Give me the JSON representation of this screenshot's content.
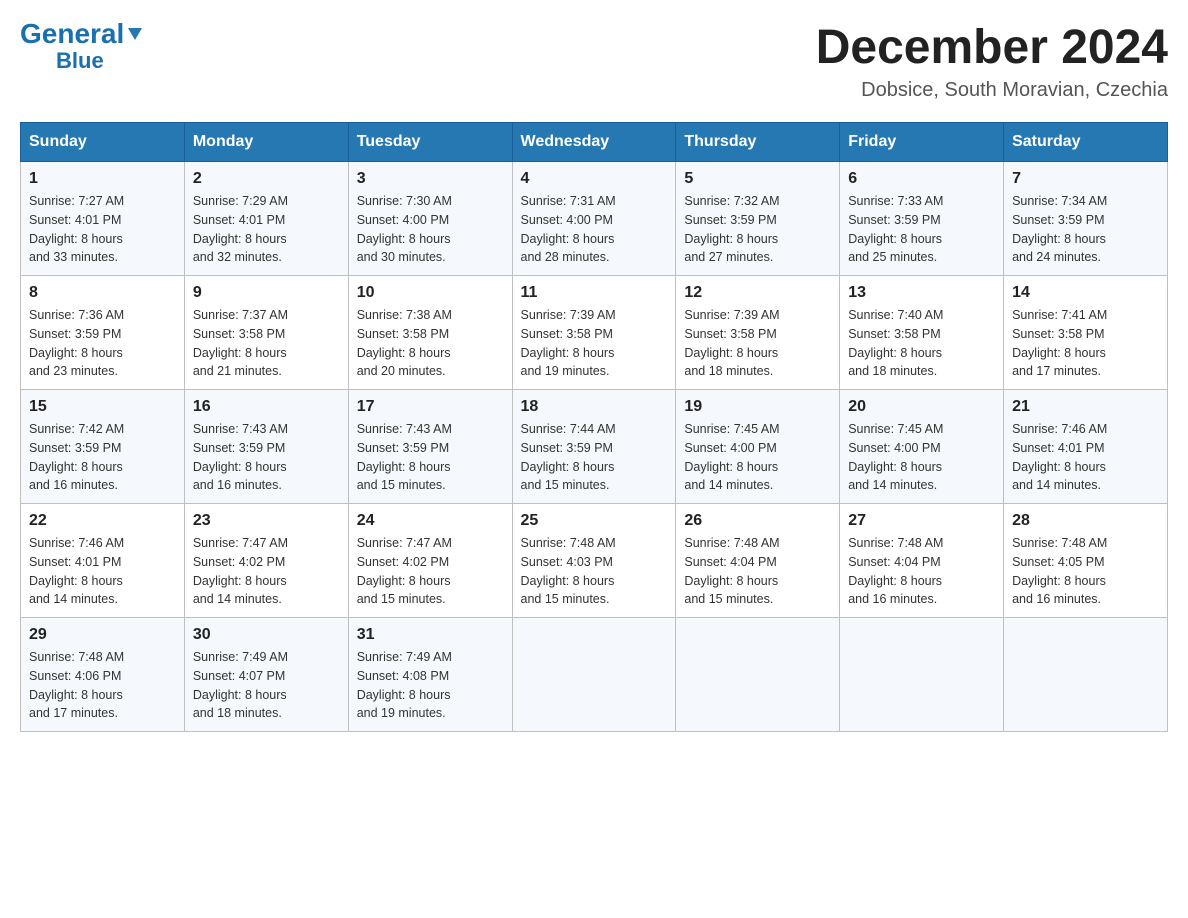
{
  "header": {
    "logo_general": "General",
    "logo_arrow": "▼",
    "logo_blue": "Blue",
    "month_title": "December 2024",
    "subtitle": "Dobsice, South Moravian, Czechia"
  },
  "days_of_week": [
    "Sunday",
    "Monday",
    "Tuesday",
    "Wednesday",
    "Thursday",
    "Friday",
    "Saturday"
  ],
  "weeks": [
    [
      {
        "day": "1",
        "sunrise": "7:27 AM",
        "sunset": "4:01 PM",
        "daylight": "8 hours and 33 minutes."
      },
      {
        "day": "2",
        "sunrise": "7:29 AM",
        "sunset": "4:01 PM",
        "daylight": "8 hours and 32 minutes."
      },
      {
        "day": "3",
        "sunrise": "7:30 AM",
        "sunset": "4:00 PM",
        "daylight": "8 hours and 30 minutes."
      },
      {
        "day": "4",
        "sunrise": "7:31 AM",
        "sunset": "4:00 PM",
        "daylight": "8 hours and 28 minutes."
      },
      {
        "day": "5",
        "sunrise": "7:32 AM",
        "sunset": "3:59 PM",
        "daylight": "8 hours and 27 minutes."
      },
      {
        "day": "6",
        "sunrise": "7:33 AM",
        "sunset": "3:59 PM",
        "daylight": "8 hours and 25 minutes."
      },
      {
        "day": "7",
        "sunrise": "7:34 AM",
        "sunset": "3:59 PM",
        "daylight": "8 hours and 24 minutes."
      }
    ],
    [
      {
        "day": "8",
        "sunrise": "7:36 AM",
        "sunset": "3:59 PM",
        "daylight": "8 hours and 23 minutes."
      },
      {
        "day": "9",
        "sunrise": "7:37 AM",
        "sunset": "3:58 PM",
        "daylight": "8 hours and 21 minutes."
      },
      {
        "day": "10",
        "sunrise": "7:38 AM",
        "sunset": "3:58 PM",
        "daylight": "8 hours and 20 minutes."
      },
      {
        "day": "11",
        "sunrise": "7:39 AM",
        "sunset": "3:58 PM",
        "daylight": "8 hours and 19 minutes."
      },
      {
        "day": "12",
        "sunrise": "7:39 AM",
        "sunset": "3:58 PM",
        "daylight": "8 hours and 18 minutes."
      },
      {
        "day": "13",
        "sunrise": "7:40 AM",
        "sunset": "3:58 PM",
        "daylight": "8 hours and 18 minutes."
      },
      {
        "day": "14",
        "sunrise": "7:41 AM",
        "sunset": "3:58 PM",
        "daylight": "8 hours and 17 minutes."
      }
    ],
    [
      {
        "day": "15",
        "sunrise": "7:42 AM",
        "sunset": "3:59 PM",
        "daylight": "8 hours and 16 minutes."
      },
      {
        "day": "16",
        "sunrise": "7:43 AM",
        "sunset": "3:59 PM",
        "daylight": "8 hours and 16 minutes."
      },
      {
        "day": "17",
        "sunrise": "7:43 AM",
        "sunset": "3:59 PM",
        "daylight": "8 hours and 15 minutes."
      },
      {
        "day": "18",
        "sunrise": "7:44 AM",
        "sunset": "3:59 PM",
        "daylight": "8 hours and 15 minutes."
      },
      {
        "day": "19",
        "sunrise": "7:45 AM",
        "sunset": "4:00 PM",
        "daylight": "8 hours and 14 minutes."
      },
      {
        "day": "20",
        "sunrise": "7:45 AM",
        "sunset": "4:00 PM",
        "daylight": "8 hours and 14 minutes."
      },
      {
        "day": "21",
        "sunrise": "7:46 AM",
        "sunset": "4:01 PM",
        "daylight": "8 hours and 14 minutes."
      }
    ],
    [
      {
        "day": "22",
        "sunrise": "7:46 AM",
        "sunset": "4:01 PM",
        "daylight": "8 hours and 14 minutes."
      },
      {
        "day": "23",
        "sunrise": "7:47 AM",
        "sunset": "4:02 PM",
        "daylight": "8 hours and 14 minutes."
      },
      {
        "day": "24",
        "sunrise": "7:47 AM",
        "sunset": "4:02 PM",
        "daylight": "8 hours and 15 minutes."
      },
      {
        "day": "25",
        "sunrise": "7:48 AM",
        "sunset": "4:03 PM",
        "daylight": "8 hours and 15 minutes."
      },
      {
        "day": "26",
        "sunrise": "7:48 AM",
        "sunset": "4:04 PM",
        "daylight": "8 hours and 15 minutes."
      },
      {
        "day": "27",
        "sunrise": "7:48 AM",
        "sunset": "4:04 PM",
        "daylight": "8 hours and 16 minutes."
      },
      {
        "day": "28",
        "sunrise": "7:48 AM",
        "sunset": "4:05 PM",
        "daylight": "8 hours and 16 minutes."
      }
    ],
    [
      {
        "day": "29",
        "sunrise": "7:48 AM",
        "sunset": "4:06 PM",
        "daylight": "8 hours and 17 minutes."
      },
      {
        "day": "30",
        "sunrise": "7:49 AM",
        "sunset": "4:07 PM",
        "daylight": "8 hours and 18 minutes."
      },
      {
        "day": "31",
        "sunrise": "7:49 AM",
        "sunset": "4:08 PM",
        "daylight": "8 hours and 19 minutes."
      },
      {
        "day": "",
        "sunrise": "",
        "sunset": "",
        "daylight": ""
      },
      {
        "day": "",
        "sunrise": "",
        "sunset": "",
        "daylight": ""
      },
      {
        "day": "",
        "sunrise": "",
        "sunset": "",
        "daylight": ""
      },
      {
        "day": "",
        "sunrise": "",
        "sunset": "",
        "daylight": ""
      }
    ]
  ]
}
